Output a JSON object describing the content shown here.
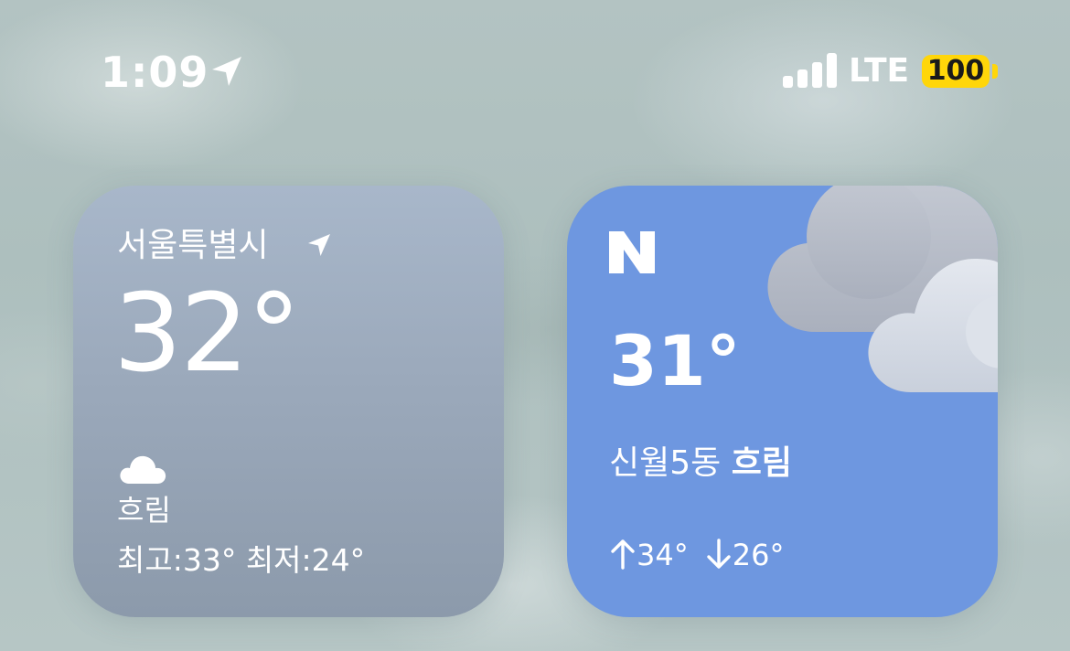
{
  "status_bar": {
    "time": "1:09",
    "network": "LTE",
    "battery": "100",
    "battery_color": "#ffd60a"
  },
  "apple_weather_widget": {
    "location": "서울특별시",
    "temperature": "32°",
    "condition": "흐림",
    "high_low": "최고:33° 최저:24°",
    "condition_icon": "cloud-icon"
  },
  "naver_weather_widget": {
    "logo_icon": "naver-n-logo",
    "temperature": "31°",
    "location": "신월5동",
    "condition": "흐림",
    "high": "34°",
    "low": "26°",
    "background_color": "#6e97e0"
  }
}
